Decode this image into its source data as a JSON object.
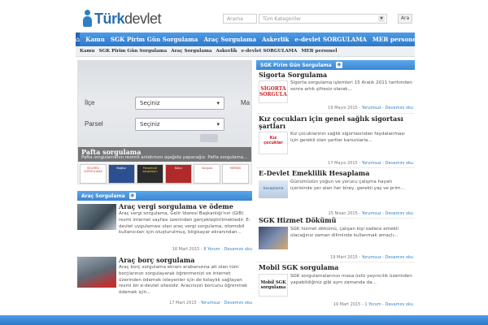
{
  "brand": {
    "part1": "Türk",
    "part2": "devlet"
  },
  "search": {
    "placeholder": "Arama",
    "category": "Tüm Kategoriler",
    "button": "Ara"
  },
  "nav": [
    "Kamu",
    "SGK Pirim Gün Sorgulama",
    "Araç Sorgulama",
    "Askerlik",
    "e-devlet SORGULAMA",
    "MEB personel"
  ],
  "subnav": [
    "Kamu",
    "SGK Pirim Gün Sorgulama",
    "Araç Sorgulama",
    "Askerlik",
    "e-devlet SORGULAMA",
    "MEB personel"
  ],
  "slider": {
    "caption_title": "Pafta sorgulama",
    "caption_text": "Pafta sorgulamanın resimli anlatımını aşağıda yapacağız. Pafta sorgulama...",
    "form_label1": "İlçe",
    "form_value1": "Seçiniz",
    "form_label2": "Parsel",
    "form_value2": "Seçiniz",
    "form_label3": "Ma",
    "thumbs": [
      "SİGORTA SORGULAMA",
      "Bağkur",
      "Parselinizi sorgulayın",
      "Kalıcı",
      "Sorgula",
      "MERNİS"
    ]
  },
  "left_section": {
    "title": "Araç Sorgulama",
    "icon": "rss-icon",
    "articles": [
      {
        "title": "Araç vergi sorgulama ve ödeme",
        "text": "Araç vergi sorgulama, Gelir İdaresi Başkanlığı'nın (GİB) resmi internet sayfası üzerinden gerçekleştirilmektedir. E-devlet uygulaması olan araç vergi sorgulama, otomobil kullanıcıları için oluşturulmuş, bilgisayar ekranından...",
        "date": "18 Mart 2015",
        "comments": "8 Yorum",
        "more": "Devamını oku"
      },
      {
        "title": "Araç borç sorgulama",
        "text": "Araç borç sorgulama ekranı arabanızına ait olan tüm borçlarınızı sorgulayarak öğrenmenizi ve internet üzerinden ödemek isteyenler için de kolaylık sağlayan resmi bir e-devlet sitesidir. Aracınızın borcunu öğrenmek ödemek için...",
        "date": "17 Mart 2015",
        "comments": "Yorumsuz",
        "more": "Devamını oku"
      }
    ]
  },
  "right_section": {
    "title": "SGK Pirim Gün Sorgulama",
    "icon": "rss-icon",
    "articles": [
      {
        "title": "Sigorta Sorgulama",
        "text": "Sigorta sorgulama işlemleri 15 Aralık 2011 tarihinden sonra artık şifresiz olarak...",
        "date": "19 Mayıs 2015",
        "comments": "Yorumsuz",
        "more": "Devamını oku",
        "thumb": "SİGORTA SORGULAMA"
      },
      {
        "title": "Kız çocukları için genel sağlık sigortası şartları",
        "text": "Kız çocuklarının sağlık sigortasından faydalanması için gerekli olan şartlar kanunlarla...",
        "date": "17 Mayıs 2015",
        "comments": "Yorumsuz",
        "more": "Devamını oku",
        "thumb": "Kız çocuklar"
      },
      {
        "title": "E-Devlet Emeklilik Hesaplama",
        "text": "Günümüzün yoğun ve yorucu çalışma hayatı içerisinde yer alan her birey, gerekli yaş ve prim...",
        "date": "15 Nisan 2015",
        "comments": "Yorumsuz",
        "more": "Devamını oku",
        "thumb": "hesaplama"
      },
      {
        "title": "SGK Hizmet Dökümü",
        "text": "SGK hizmet dökümü, çalışan kişi sadece emekli olacağınız zaman diliminde kullanmak amaçlı...",
        "date": "19 Mart 2015",
        "comments": "Yorumsuz",
        "more": "Devamını oku",
        "thumb": ""
      },
      {
        "title": "Mobil SGK sorgulama",
        "text": "SGK sorgulamalarınızı masa üstü yayıncılık üzerinden yapabildiğiniz gibi aynı zamanda da...",
        "date": "19 Mart 2015",
        "comments": "1 Yorum",
        "more": "Devamını oku",
        "thumb": "Mobil SGK sorgulama"
      }
    ]
  }
}
